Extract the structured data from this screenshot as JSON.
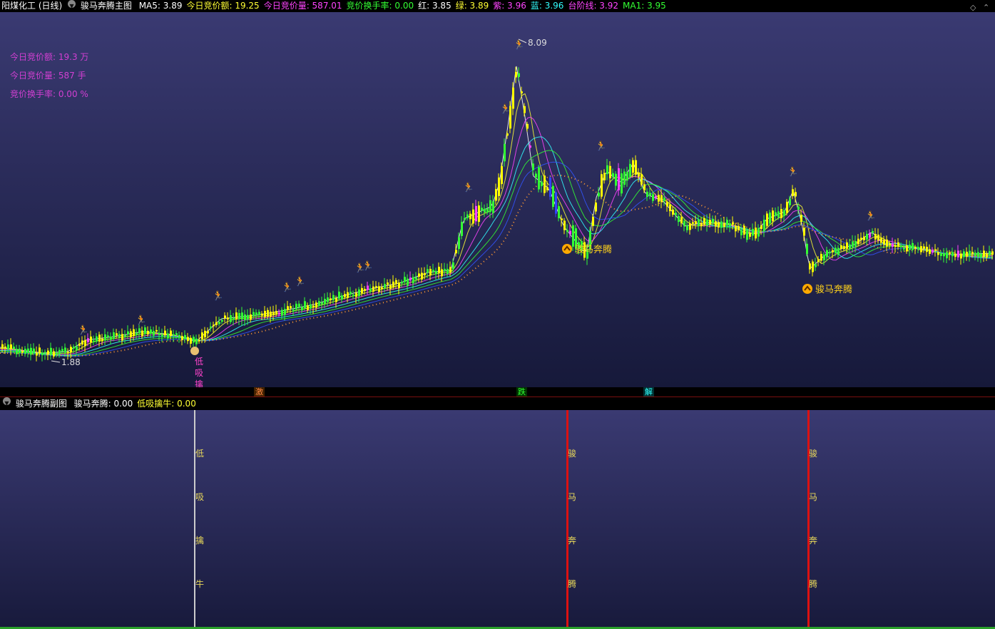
{
  "main_header": {
    "stock": "阳煤化工 (日线)",
    "indicator": "骏马奔腾主图",
    "items": [
      {
        "label": "MA5: 3.89",
        "color": "#ffffff"
      },
      {
        "label": "今日竞价额: 19.25",
        "color": "#ffff33"
      },
      {
        "label": "今日竞价量: 587.01",
        "color": "#ff44ff"
      },
      {
        "label": "竞价换手率: 0.00",
        "color": "#33ff33"
      },
      {
        "label": "红: 3.85",
        "color": "#ffffff"
      },
      {
        "label": "绿: 3.89",
        "color": "#ffff33"
      },
      {
        "label": "紫: 3.96",
        "color": "#ff44ff"
      },
      {
        "label": "蓝: 3.96",
        "color": "#33ffff"
      },
      {
        "label": "台阶线: 3.92",
        "color": "#ff44ff"
      },
      {
        "label": "MA1: 3.95",
        "color": "#33ff33"
      }
    ]
  },
  "corner_icons": {
    "diamond": "◇",
    "up": "⌃"
  },
  "indicator_box": [
    {
      "label": "今日竞价额: 19.3  万"
    },
    {
      "label": "今日竞价量: 587  手"
    },
    {
      "label": "竞价换手率: 0.00  %"
    }
  ],
  "price_labels": {
    "high": "8.09",
    "low": "1.88"
  },
  "signals": {
    "junma": "骏马奔腾",
    "dixi": [
      "低",
      "吸",
      "擒"
    ]
  },
  "strip_labels": [
    {
      "text": "激",
      "color": "#ff8844"
    },
    {
      "text": "跌",
      "color": "#33ff33"
    },
    {
      "text": "解",
      "color": "#33ffff"
    }
  ],
  "sub_header": {
    "indicator": "骏马奔腾副图",
    "items": [
      {
        "label": "骏马奔腾: 0.00",
        "color": "#ffffff"
      },
      {
        "label": "低吸擒牛: 0.00",
        "color": "#ffff33"
      }
    ]
  },
  "sub_columns": [
    {
      "chars": [
        "低",
        "吸",
        "擒",
        "牛"
      ],
      "line_color": "#cccccc"
    },
    {
      "chars": [
        "骏",
        "马",
        "奔",
        "腾"
      ],
      "line_color": "#dd1111"
    },
    {
      "chars": [
        "骏",
        "马",
        "奔",
        "腾"
      ],
      "line_color": "#dd1111"
    }
  ],
  "colors": {
    "up": "#ffff00",
    "down": "#33ff33",
    "buy_signal": "#ff44ff",
    "sell_signal": "#3344ff",
    "step_line": "#ff9933"
  }
}
